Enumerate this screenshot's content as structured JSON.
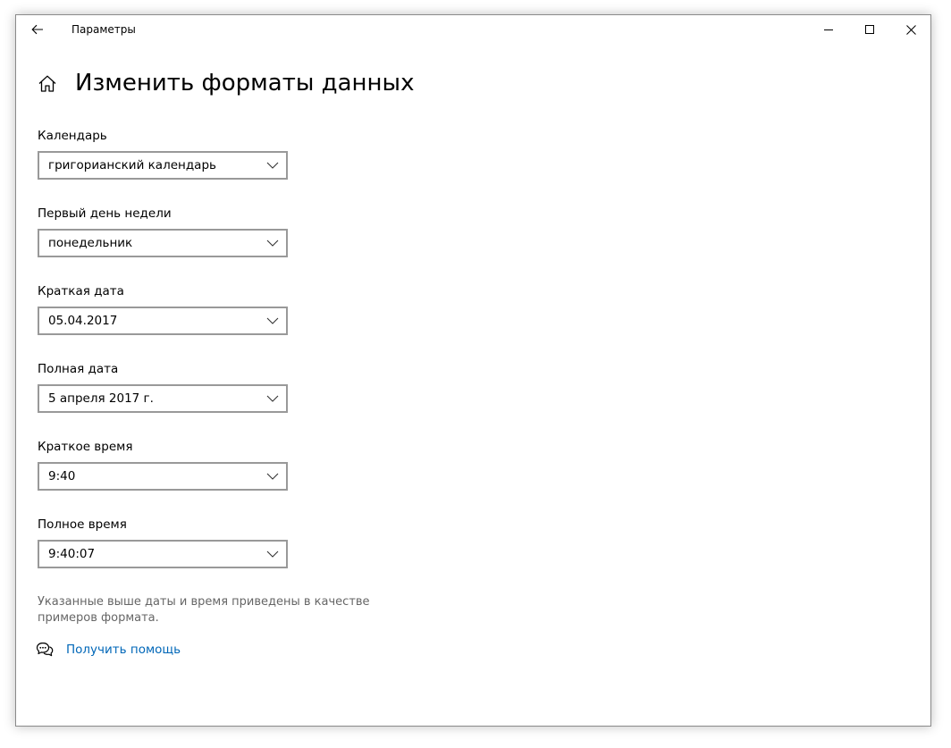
{
  "window": {
    "title": "Параметры"
  },
  "header": {
    "title": "Изменить форматы данных"
  },
  "fields": [
    {
      "label": "Календарь",
      "value": "григорианский календарь"
    },
    {
      "label": "Первый день недели",
      "value": "понедельник"
    },
    {
      "label": "Краткая дата",
      "value": "05.04.2017"
    },
    {
      "label": "Полная дата",
      "value": "5 апреля 2017 г."
    },
    {
      "label": "Краткое время",
      "value": "9:40"
    },
    {
      "label": "Полное время",
      "value": "9:40:07"
    }
  ],
  "note": "Указанные выше даты и время приведены в качестве примеров формата.",
  "help": {
    "link_label": "Получить помощь"
  },
  "colors": {
    "link": "#0067b8",
    "note_text": "#666666",
    "dropdown_border": "#999999"
  },
  "icons": {
    "back": "back-arrow-icon",
    "home": "home-icon",
    "minimize": "minimize-icon",
    "maximize": "maximize-icon",
    "close": "close-icon",
    "chevron": "chevron-down-icon",
    "help": "help-chat-icon"
  }
}
